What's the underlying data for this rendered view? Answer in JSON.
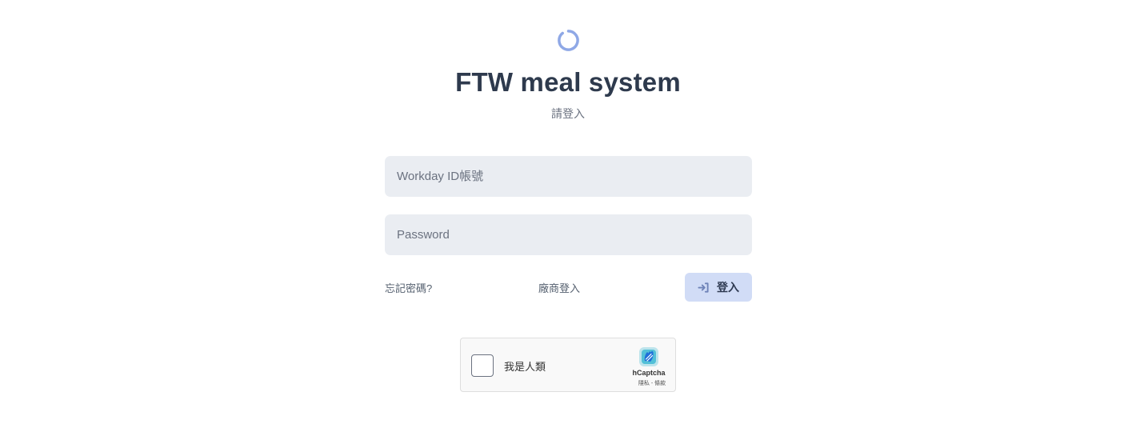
{
  "header": {
    "title": "FTW meal system",
    "subtitle": "請登入",
    "logo_icon": "loading-ring-icon",
    "accent_color": "#8fa8e6"
  },
  "form": {
    "username_placeholder": "Workday ID帳號",
    "username_value": "",
    "password_placeholder": "Password",
    "password_value": "",
    "forgot_password_label": "忘記密碼?",
    "vendor_login_label": "廠商登入",
    "login_button_label": "登入",
    "login_button_icon": "sign-in-icon",
    "login_button_color": "#d1dcf6"
  },
  "captcha": {
    "label": "我是人類",
    "brand": "hCaptcha",
    "links": "隱私 - 條款",
    "logo_icon": "hcaptcha-hand-icon",
    "checked": false
  }
}
